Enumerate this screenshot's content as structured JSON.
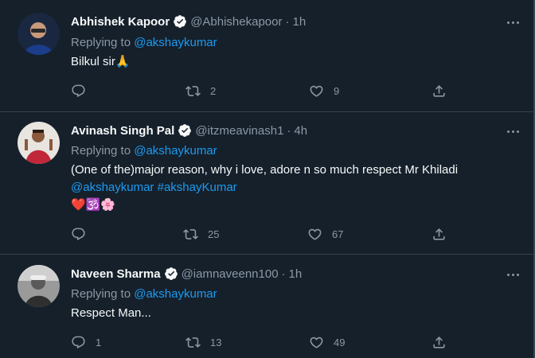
{
  "tweets": [
    {
      "name": "Abhishek Kapoor",
      "handle": "@Abhishekapoor",
      "separator": "·",
      "time": "1h",
      "replying_prefix": "Replying to",
      "replying_to": "@akshaykumar",
      "text": "Bilkul sir🙏",
      "replies": "",
      "retweets": "2",
      "likes": "9"
    },
    {
      "name": "Avinash Singh Pal",
      "handle": "@itzmeavinash1",
      "separator": "·",
      "time": "4h",
      "replying_prefix": "Replying to",
      "replying_to": "@akshaykumar",
      "text_line1": "(One of the)major reason, why i love, adore n so much respect Mr Khiladi",
      "mention": "@akshaykumar",
      "hashtag": "#akshayKumar",
      "emojis": "❤️🕉️🌸",
      "replies": "",
      "retweets": "25",
      "likes": "67"
    },
    {
      "name": "Naveen Sharma",
      "handle": "@iamnaveenn100",
      "separator": "·",
      "time": "1h",
      "replying_prefix": "Replying to",
      "replying_to": "@akshaykumar",
      "text": "Respect Man...",
      "replies": "1",
      "retweets": "13",
      "likes": "49"
    }
  ],
  "colors": {
    "background": "#15202b",
    "text": "#f7f9f9",
    "muted": "#8b98a5",
    "link": "#1d9bf0",
    "divider": "#38444d"
  },
  "icons": [
    "verified-badge-icon",
    "more-options-icon",
    "reply-icon",
    "retweet-icon",
    "like-icon",
    "share-icon"
  ]
}
